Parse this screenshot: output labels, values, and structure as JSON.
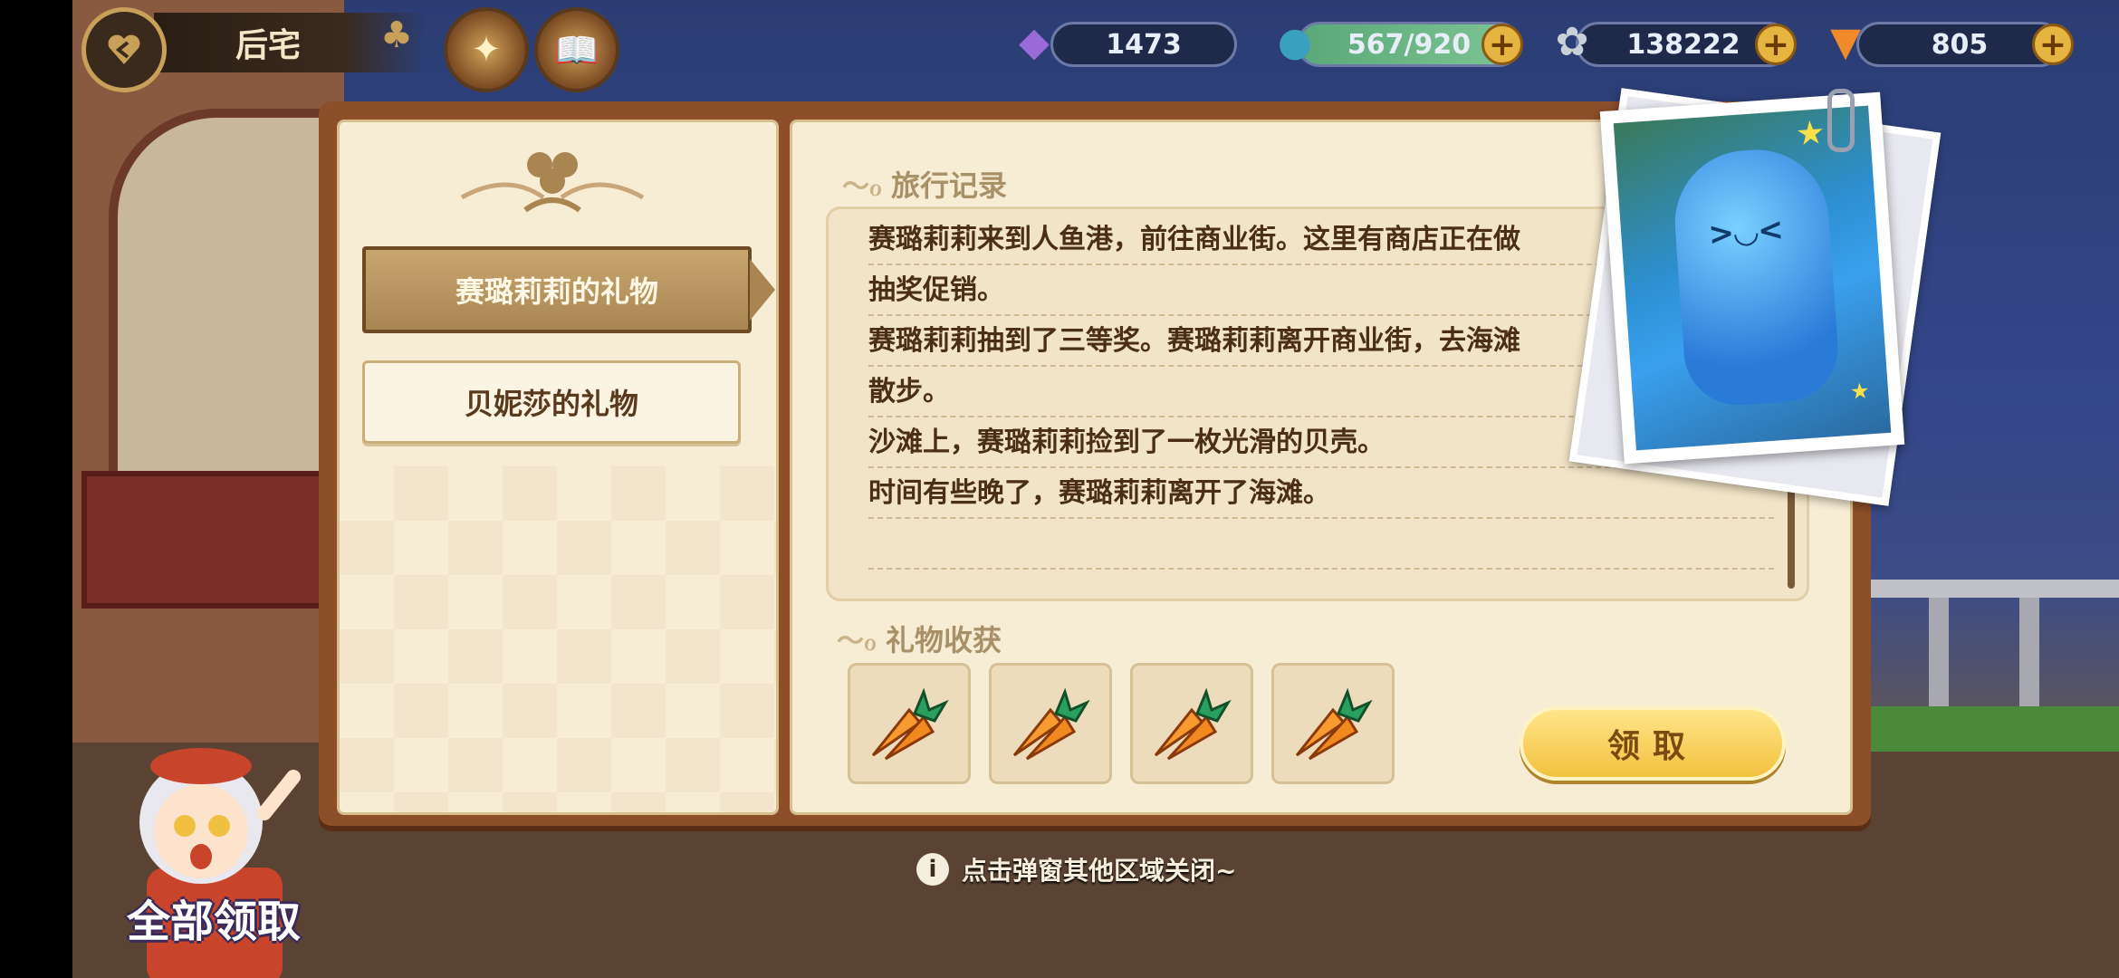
{
  "header": {
    "title": "后宅",
    "back_icon": "heart-back-icon",
    "menu_icons": [
      "compass-emblem-icon",
      "spellbook-icon"
    ]
  },
  "resources": [
    {
      "name": "gem",
      "icon": "purple-crystal-icon",
      "value": "1473",
      "has_plus": false
    },
    {
      "name": "stamina",
      "icon": "potion-jar-icon",
      "value": "567/920",
      "has_plus": true
    },
    {
      "name": "coins",
      "icon": "clover-coin-icon",
      "value": "138222",
      "has_plus": true
    },
    {
      "name": "carrots",
      "icon": "carrot-icon",
      "value": "805",
      "has_plus": true
    }
  ],
  "sidebar": {
    "tabs": [
      {
        "label": "赛璐莉莉的礼物",
        "active": true
      },
      {
        "label": "贝妮莎的礼物",
        "active": false
      }
    ]
  },
  "travel_log": {
    "heading": "旅行记录",
    "lines": [
      "赛璐莉莉来到人鱼港，前往商业街。这里有商店正在做",
      "抽奖促销。",
      "赛璐莉莉抽到了三等奖。赛璐莉莉离开商业街，去海滩",
      "散步。",
      "沙滩上，赛璐莉莉捡到了一枚光滑的贝壳。",
      "时间有些晚了，赛璐莉莉离开了海滩。"
    ]
  },
  "gifts": {
    "heading": "礼物收获",
    "items": [
      "carrot-bundle-icon",
      "carrot-bundle-icon",
      "carrot-bundle-icon",
      "carrot-bundle-icon"
    ],
    "claim_label": "领取"
  },
  "hint_text": "点击弹窗其他区域关闭~",
  "claim_all_label": "全部领取",
  "colors": {
    "panel": "#8c4f2a",
    "page": "#f7ecd4",
    "button": "#f2c13e",
    "text": "#4a2e16"
  }
}
